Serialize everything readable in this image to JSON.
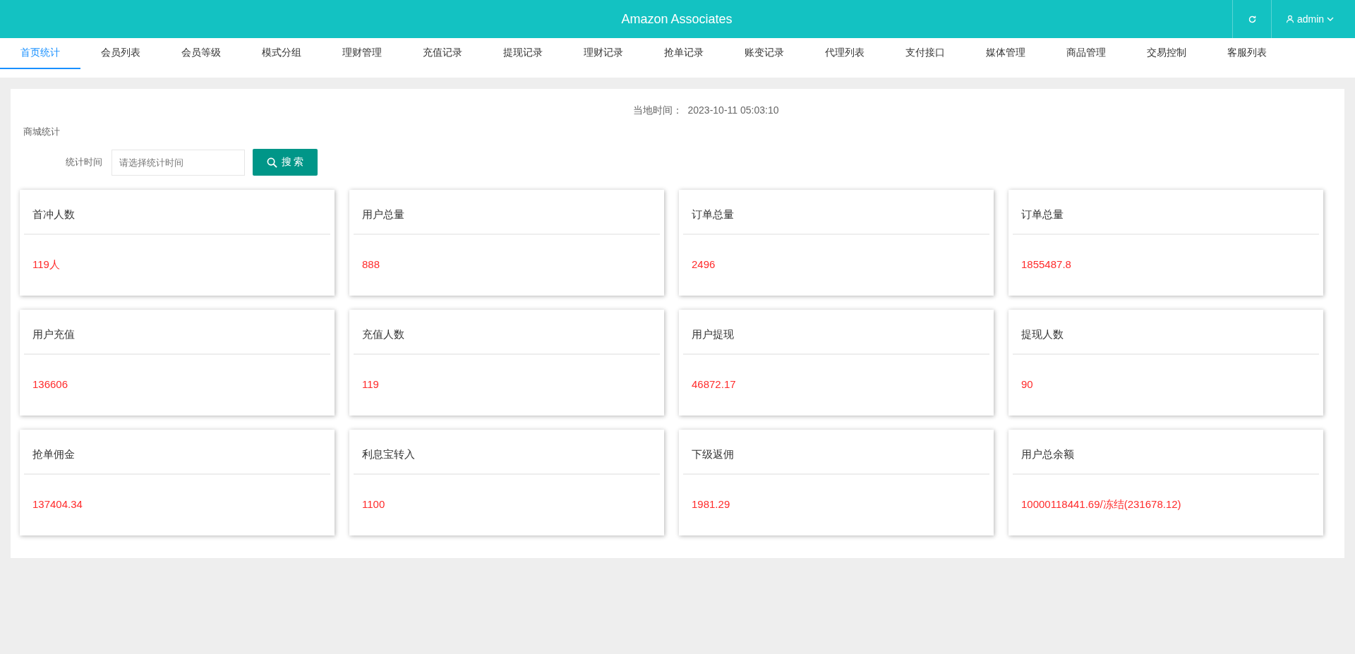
{
  "header": {
    "title": "Amazon Associates",
    "user": "admin"
  },
  "tabs": [
    {
      "label": "首页统计",
      "selected": true
    },
    {
      "label": "会员列表",
      "selected": false
    },
    {
      "label": "会员等级",
      "selected": false
    },
    {
      "label": "模式分组",
      "selected": false
    },
    {
      "label": "理财管理",
      "selected": false
    },
    {
      "label": "充值记录",
      "selected": false
    },
    {
      "label": "提现记录",
      "selected": false
    },
    {
      "label": "理财记录",
      "selected": false
    },
    {
      "label": "抢单记录",
      "selected": false
    },
    {
      "label": "账变记录",
      "selected": false
    },
    {
      "label": "代理列表",
      "selected": false
    },
    {
      "label": "支付接口",
      "selected": false
    },
    {
      "label": "媒体管理",
      "selected": false
    },
    {
      "label": "商品管理",
      "selected": false
    },
    {
      "label": "交易控制",
      "selected": false
    },
    {
      "label": "客服列表",
      "selected": false
    }
  ],
  "local_time": {
    "label": "当地时间：",
    "value": "2023-10-11 05:03:10"
  },
  "section_title": "商城统计",
  "filter": {
    "label": "统计时间",
    "placeholder": "请选择统计时间",
    "button": "搜 索"
  },
  "stats": [
    {
      "title": "首冲人数",
      "value": "119人"
    },
    {
      "title": "用户总量",
      "value": "888"
    },
    {
      "title": "订单总量",
      "value": "2496"
    },
    {
      "title": "订单总量",
      "value": "1855487.8"
    },
    {
      "title": "用户充值",
      "value": "136606"
    },
    {
      "title": "充值人数",
      "value": "119"
    },
    {
      "title": "用户提现",
      "value": "46872.17"
    },
    {
      "title": "提现人数",
      "value": "90"
    },
    {
      "title": "抢单佣金",
      "value": "137404.34"
    },
    {
      "title": "利息宝转入",
      "value": "1100"
    },
    {
      "title": "下级返佣",
      "value": "1981.29"
    },
    {
      "title": "用户总余额",
      "value": "10000118441.69/冻结(231678.12)"
    }
  ]
}
